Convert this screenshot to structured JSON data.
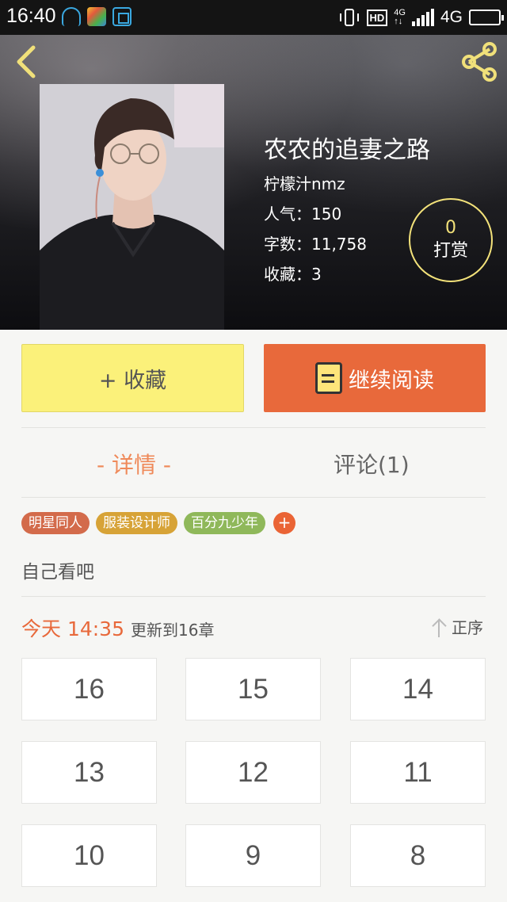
{
  "status_bar": {
    "time": "16:40",
    "hd": "HD",
    "net_small_top": "4G",
    "net_small_bottom": "↑↓",
    "network": "4G",
    "battery_level": 0.92
  },
  "header": {
    "back_icon": "chevron-left-icon",
    "share_icon": "share-icon",
    "icon_color": "#f0e07a"
  },
  "book": {
    "title": "农农的追妻之路",
    "author": "柠檬汁nmz",
    "popularity": "人气：150",
    "word_count": "字数：11,758",
    "favorites": "收藏：3"
  },
  "tip": {
    "count": "0",
    "label": "打赏"
  },
  "actions": {
    "collect_label": "+ 收藏",
    "read_label": "继续阅读"
  },
  "tabs": {
    "details": "- 详情 -",
    "comments": "评论(1)"
  },
  "tags": [
    {
      "label": "明星同人",
      "color": "#d36b4b"
    },
    {
      "label": "服装设计师",
      "color": "#d7a337"
    },
    {
      "label": "百分九少年",
      "color": "#8fb85a"
    }
  ],
  "tag_add": "+",
  "description": "自己看吧",
  "update": {
    "label": "今天 14:35",
    "text": "更新到16章"
  },
  "sort": {
    "label": "正序",
    "icon": "arrow-up-icon"
  },
  "chapters": [
    "16",
    "15",
    "14",
    "13",
    "12",
    "11",
    "10",
    "9",
    "8"
  ],
  "colors": {
    "accent": "#e8693b",
    "collect_bg": "#fbf17a",
    "tab_active": "#ef8a5a"
  }
}
